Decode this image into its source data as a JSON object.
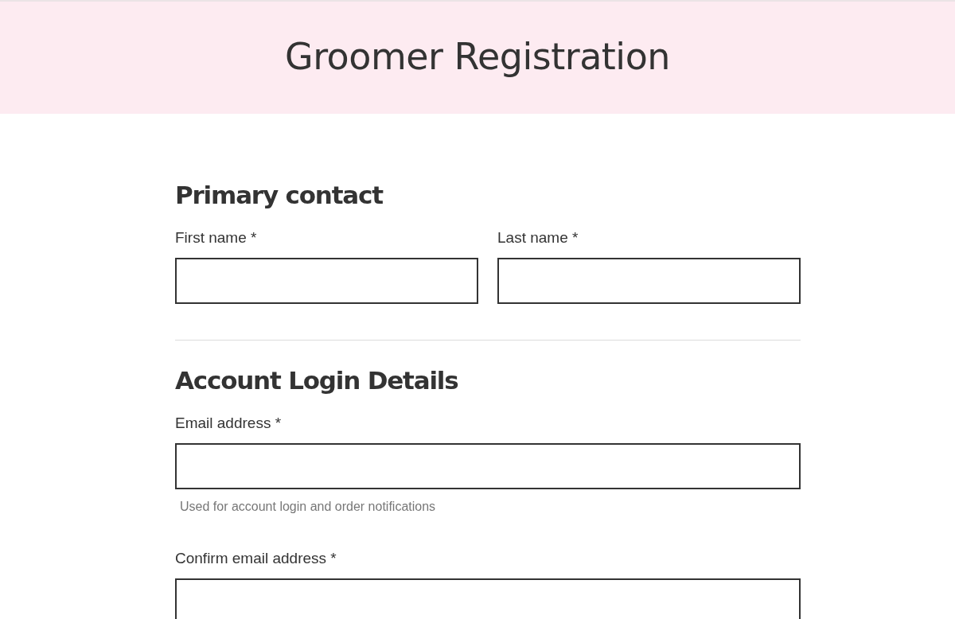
{
  "header": {
    "title": "Groomer Registration"
  },
  "sections": [
    {
      "heading": "Primary contact",
      "rows": [
        {
          "fields": [
            {
              "label": "First name *"
            },
            {
              "label": "Last name *"
            }
          ]
        }
      ]
    },
    {
      "heading": "Account Login Details",
      "rows": [
        {
          "fields": [
            {
              "label": "Email address *",
              "hint": "Used for account login and order notifications"
            }
          ]
        },
        {
          "fields": [
            {
              "label": "Confirm email address *"
            }
          ]
        }
      ]
    }
  ]
}
